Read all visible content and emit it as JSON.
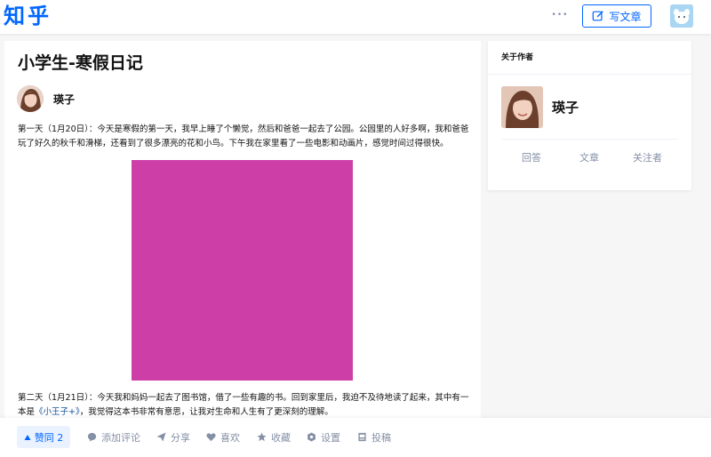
{
  "header": {
    "logo": "知乎",
    "more_label": "•••",
    "write_label": "写文章"
  },
  "article": {
    "title": "小学生-寒假日记",
    "author": "瑛子",
    "para1": "第一天（1月20日）：今天是寒假的第一天，我早上睡了个懒觉，然后和爸爸一起去了公园。公园里的人好多啊，我和爸爸玩了好久的秋千和滑梯，还看到了很多漂亮的花和小鸟。下午我在家里看了一些电影和动画片，感觉时间过得很快。",
    "para2_before": "第二天（1月21日）：今天我和妈妈一起去了图书馆，借了一些有趣的书。回到家里后，我迫不及待地读了起来，其中有一本是",
    "para2_link": "《小王子+》",
    "para2_after": "，我觉得这本书非常有意思，让我对生命和人生有了更深刻的理解。",
    "image_color": "#cd3ea6"
  },
  "actions": {
    "vote_label": "赞同 2",
    "comment_label": "添加评论",
    "share_label": "分享",
    "like_label": "喜欢",
    "collect_label": "收藏",
    "settings_label": "设置",
    "submit_label": "投稿"
  },
  "sidebar": {
    "header": "关于作者",
    "name": "瑛子",
    "stats": [
      "回答",
      "文章",
      "关注者"
    ]
  },
  "colors": {
    "brand": "#0066ff",
    "muted": "#8590a6",
    "link": "#175199"
  }
}
